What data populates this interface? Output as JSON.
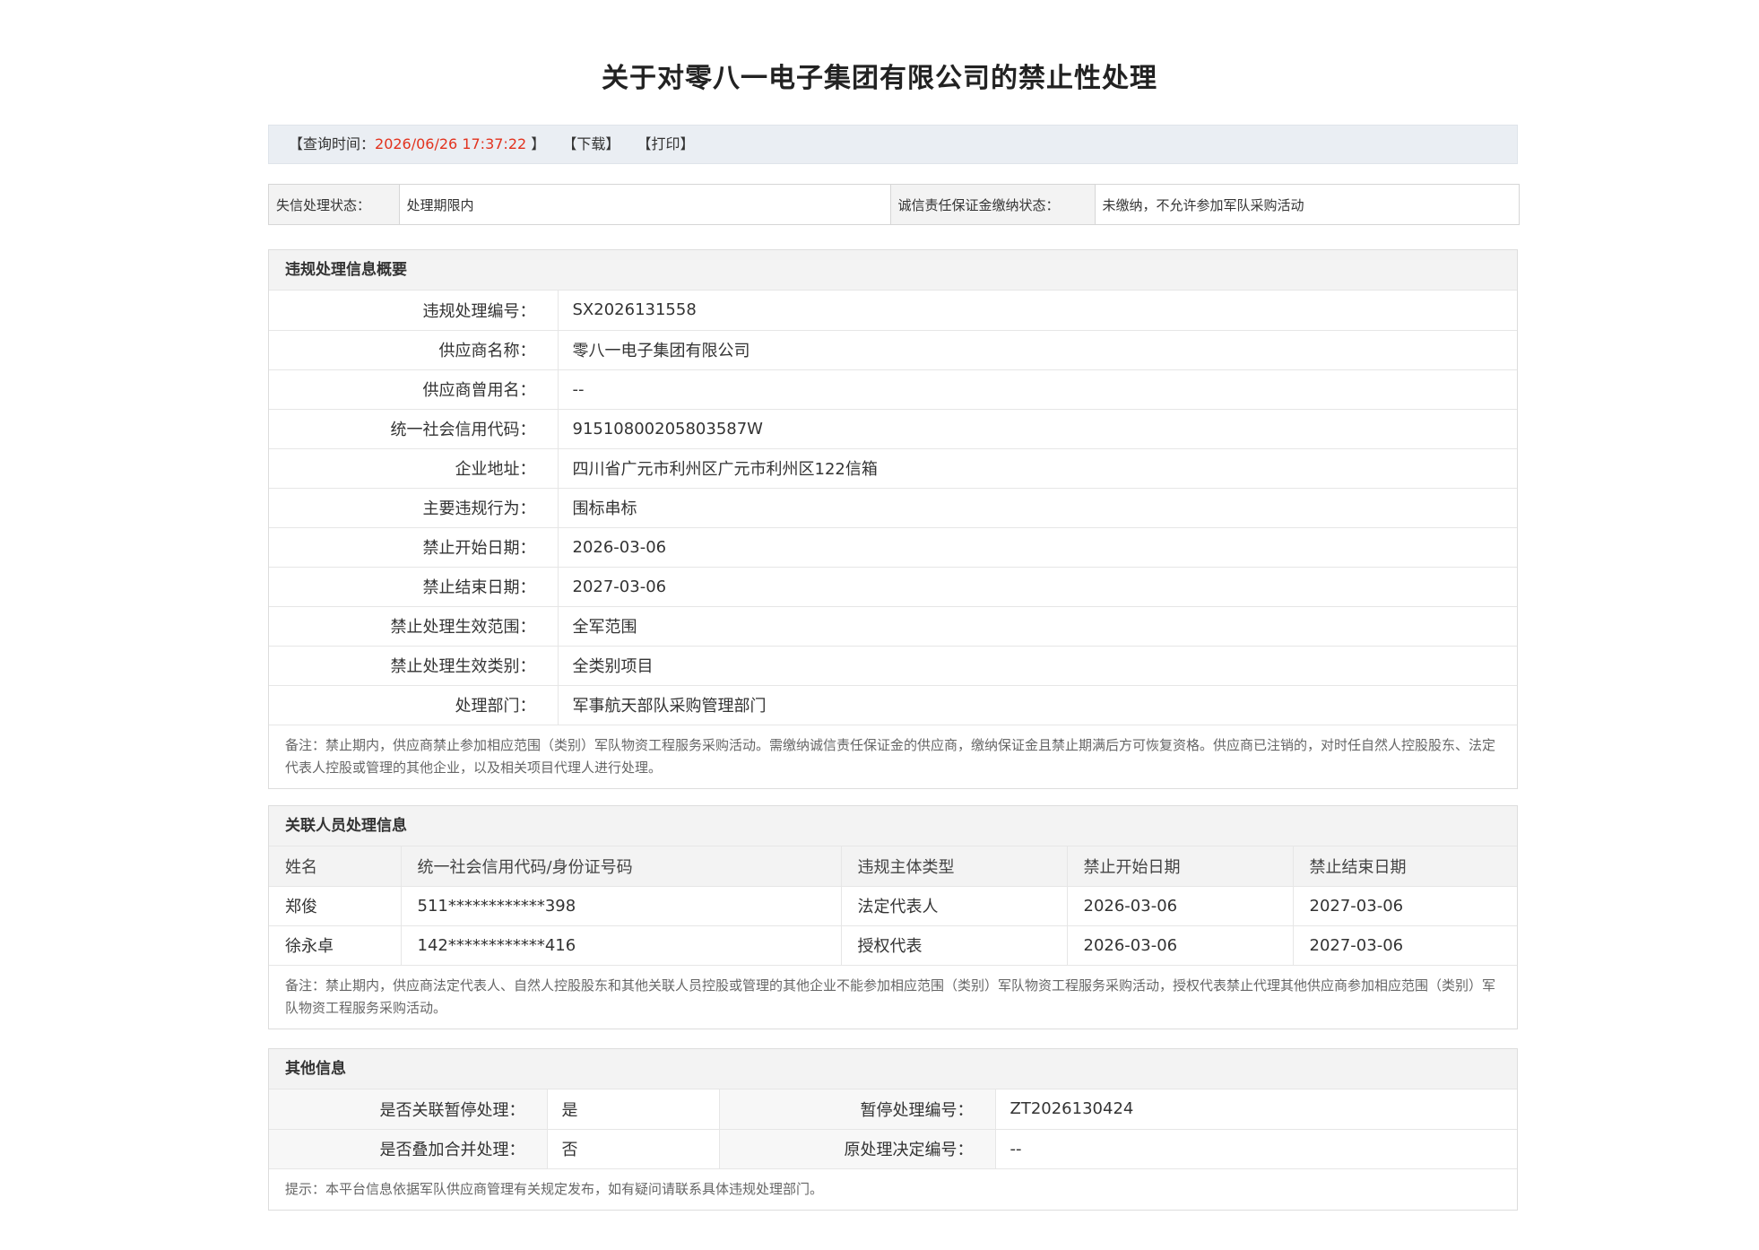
{
  "title": "关于对零八一电子集团有限公司的禁止性处理",
  "query": {
    "label_open": "【查询时间：",
    "time": "2026/06/26 17:37:22",
    "label_close": "】",
    "download": "【下载】",
    "print": "【打印】"
  },
  "status": {
    "credit_label": "失信处理状态：",
    "credit_value": "处理期限内",
    "deposit_label": "诚信责任保证金缴纳状态：",
    "deposit_value": "未缴纳，不允许参加军队采购活动"
  },
  "summary": {
    "heading": "违规处理信息概要",
    "rows": [
      {
        "k": "违规处理编号：",
        "v": "SX2026131558"
      },
      {
        "k": "供应商名称：",
        "v": "零八一电子集团有限公司"
      },
      {
        "k": "供应商曾用名：",
        "v": "--"
      },
      {
        "k": "统一社会信用代码：",
        "v": "91510800205803587W"
      },
      {
        "k": "企业地址：",
        "v": "四川省广元市利州区广元市利州区122信箱"
      },
      {
        "k": "主要违规行为：",
        "v": "围标串标"
      },
      {
        "k": "禁止开始日期：",
        "v": "2026-03-06"
      },
      {
        "k": "禁止结束日期：",
        "v": "2027-03-06"
      },
      {
        "k": "禁止处理生效范围：",
        "v": "全军范围"
      },
      {
        "k": "禁止处理生效类别：",
        "v": "全类别项目"
      },
      {
        "k": "处理部门：",
        "v": "军事航天部队采购管理部门"
      }
    ],
    "note": "备注：禁止期内，供应商禁止参加相应范围（类别）军队物资工程服务采购活动。需缴纳诚信责任保证金的供应商，缴纳保证金且禁止期满后方可恢复资格。供应商已注销的，对时任自然人控股股东、法定代表人控股或管理的其他企业，以及相关项目代理人进行处理。"
  },
  "related": {
    "heading": "关联人员处理信息",
    "columns": [
      "姓名",
      "统一社会信用代码/身份证号码",
      "违规主体类型",
      "禁止开始日期",
      "禁止结束日期"
    ],
    "rows": [
      [
        "郑俊",
        "511************398",
        "法定代表人",
        "2026-03-06",
        "2027-03-06"
      ],
      [
        "徐永卓",
        "142************416",
        "授权代表",
        "2026-03-06",
        "2027-03-06"
      ]
    ],
    "note": "备注：禁止期内，供应商法定代表人、自然人控股股东和其他关联人员控股或管理的其他企业不能参加相应范围（类别）军队物资工程服务采购活动，授权代表禁止代理其他供应商参加相应范围（类别）军队物资工程服务采购活动。"
  },
  "other": {
    "heading": "其他信息",
    "rows": [
      {
        "k1": "是否关联暂停处理：",
        "v1": "是",
        "k2": "暂停处理编号：",
        "v2": "ZT2026130424"
      },
      {
        "k1": "是否叠加合并处理：",
        "v1": "否",
        "k2": "原处理决定编号：",
        "v2": "--"
      }
    ],
    "note": "提示：本平台信息依据军队供应商管理有关规定发布，如有疑问请联系具体违规处理部门。"
  },
  "colors": {
    "accent_time": "#e2321e",
    "header_bg": "#f3f3f3",
    "query_bg": "#eaeef3"
  }
}
